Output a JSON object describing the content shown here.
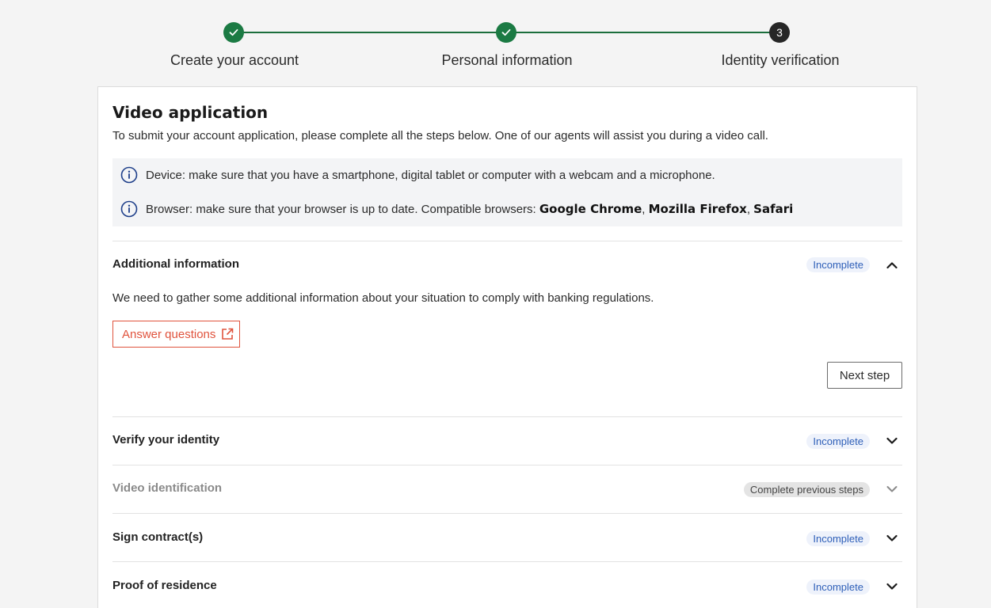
{
  "stepper": {
    "steps": [
      {
        "label": "Create your account",
        "state": "done"
      },
      {
        "label": "Personal information",
        "state": "done"
      },
      {
        "label": "Identity verification",
        "state": "current",
        "number": "3"
      }
    ]
  },
  "card": {
    "title": "Video application",
    "subtitle": "To submit your account application, please complete all the steps below. One of our agents will assist you during a video call.",
    "info": {
      "device": "Device: make sure that you have a smartphone, digital tablet or computer with a webcam and a microphone.",
      "browser_prefix": "Browser: make sure that your browser is up to date. Compatible browsers: ",
      "browser_chrome": "Google Chrome",
      "sep1": ", ",
      "browser_firefox": "Mozilla Firefox",
      "sep2": ", ",
      "browser_safari": "Safari"
    },
    "sections": {
      "additional": {
        "title": "Additional information",
        "status": "Incomplete",
        "description": "We need to gather some additional information about your situation to comply with banking regulations.",
        "answer_label": "Answer questions",
        "next_label": "Next step",
        "icon": "chevron-up-icon"
      },
      "verify": {
        "title": "Verify your identity",
        "status": "Incomplete",
        "icon": "chevron-down-icon"
      },
      "video": {
        "title": "Video identification",
        "status": "Complete previous steps",
        "icon": "chevron-down-icon"
      },
      "sign": {
        "title": "Sign contract(s)",
        "status": "Incomplete",
        "icon": "chevron-down-icon"
      },
      "proof": {
        "title": "Proof of residence",
        "status": "Incomplete",
        "icon": "chevron-down-icon"
      }
    }
  },
  "colors": {
    "step_done": "#1b7a43",
    "step_current": "#262626",
    "accent_orange": "#e0533d",
    "badge_blue": "#2e5fb8"
  }
}
